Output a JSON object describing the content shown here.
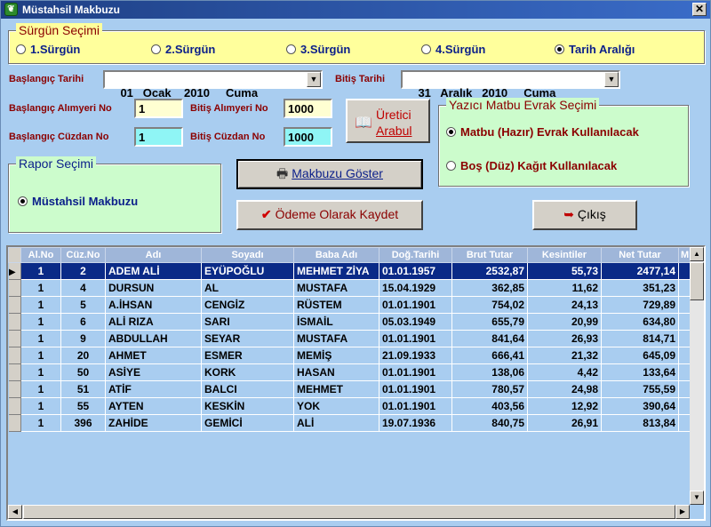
{
  "window": {
    "title": "Müstahsil Makbuzu",
    "close_label": "✕"
  },
  "surgun": {
    "legend": "Sürgün Seçimi",
    "options": [
      "1.Sürgün",
      "2.Sürgün",
      "3.Sürgün",
      "4.Sürgün",
      "Tarih Aralığı"
    ],
    "selected": "Tarih Aralığı"
  },
  "dates": {
    "start_label": "Başlangıç Tarihi",
    "start_value": "01   Ocak    2010     Cuma",
    "end_label": "Bitiş Tarihi",
    "end_value": "31   Aralık   2010     Cuma"
  },
  "fields": {
    "start_alimyeri_label": "Başlangıç Alımyeri No",
    "start_alimyeri_value": "1",
    "end_alimyeri_label": "Bitiş Alımyeri No",
    "end_alimyeri_value": "1000",
    "start_cuzdan_label": "Başlangıç Cüzdan No",
    "start_cuzdan_value": "1",
    "end_cuzdan_label": "Bitiş Cüzdan No",
    "end_cuzdan_value": "1000"
  },
  "buttons": {
    "uretici_line1": "Üretici",
    "uretici_line2": "Arabul",
    "makbuz": "Makbuzu Göster",
    "odeme": "Ödeme Olarak Kaydet",
    "cikis": "Çıkış"
  },
  "yazici": {
    "legend": "Yazıcı Matbu Evrak Seçimi",
    "options": [
      "Matbu (Hazır) Evrak Kullanılacak",
      "Boş (Düz) Kağıt Kullanılacak"
    ],
    "selected": "Matbu (Hazır) Evrak Kullanılacak"
  },
  "rapor": {
    "legend": "Rapor Seçimi",
    "options": [
      "Müstahsil Makbuzu"
    ],
    "selected": "Müstahsil Makbuzu"
  },
  "grid": {
    "columns": [
      "Al.No",
      "Cüz.No",
      "Adı",
      "Soyadı",
      "Baba Adı",
      "Doğ.Tarihi",
      "Brut Tutar",
      "Kesintiler",
      "Net Tutar",
      "M"
    ],
    "rows": [
      [
        "1",
        "2",
        "ADEM ALİ",
        "EYÜPOĞLU",
        "MEHMET ZİYA",
        "01.01.1957",
        "2532,87",
        "55,73",
        "2477,14"
      ],
      [
        "1",
        "4",
        "DURSUN",
        "AL",
        "MUSTAFA",
        "15.04.1929",
        "362,85",
        "11,62",
        "351,23"
      ],
      [
        "1",
        "5",
        "A.İHSAN",
        "CENGİZ",
        "RÜSTEM",
        "01.01.1901",
        "754,02",
        "24,13",
        "729,89"
      ],
      [
        "1",
        "6",
        "ALİ RIZA",
        "SARI",
        "İSMAİL",
        "05.03.1949",
        "655,79",
        "20,99",
        "634,80"
      ],
      [
        "1",
        "9",
        "ABDULLAH",
        "SEYAR",
        "MUSTAFA",
        "01.01.1901",
        "841,64",
        "26,93",
        "814,71"
      ],
      [
        "1",
        "20",
        "AHMET",
        "ESMER",
        "MEMİŞ",
        "21.09.1933",
        "666,41",
        "21,32",
        "645,09"
      ],
      [
        "1",
        "50",
        "ASİYE",
        "KORK",
        "HASAN",
        "01.01.1901",
        "138,06",
        "4,42",
        "133,64"
      ],
      [
        "1",
        "51",
        "ATİF",
        "BALCI",
        "MEHMET",
        "01.01.1901",
        "780,57",
        "24,98",
        "755,59"
      ],
      [
        "1",
        "55",
        "AYTEN",
        "KESKİN",
        "YOK",
        "01.01.1901",
        "403,56",
        "12,92",
        "390,64"
      ],
      [
        "1",
        "396",
        "ZAHİDE",
        "GEMİCİ",
        "ALİ",
        "19.07.1936",
        "840,75",
        "26,91",
        "813,84"
      ]
    ],
    "selected_row": 0
  }
}
